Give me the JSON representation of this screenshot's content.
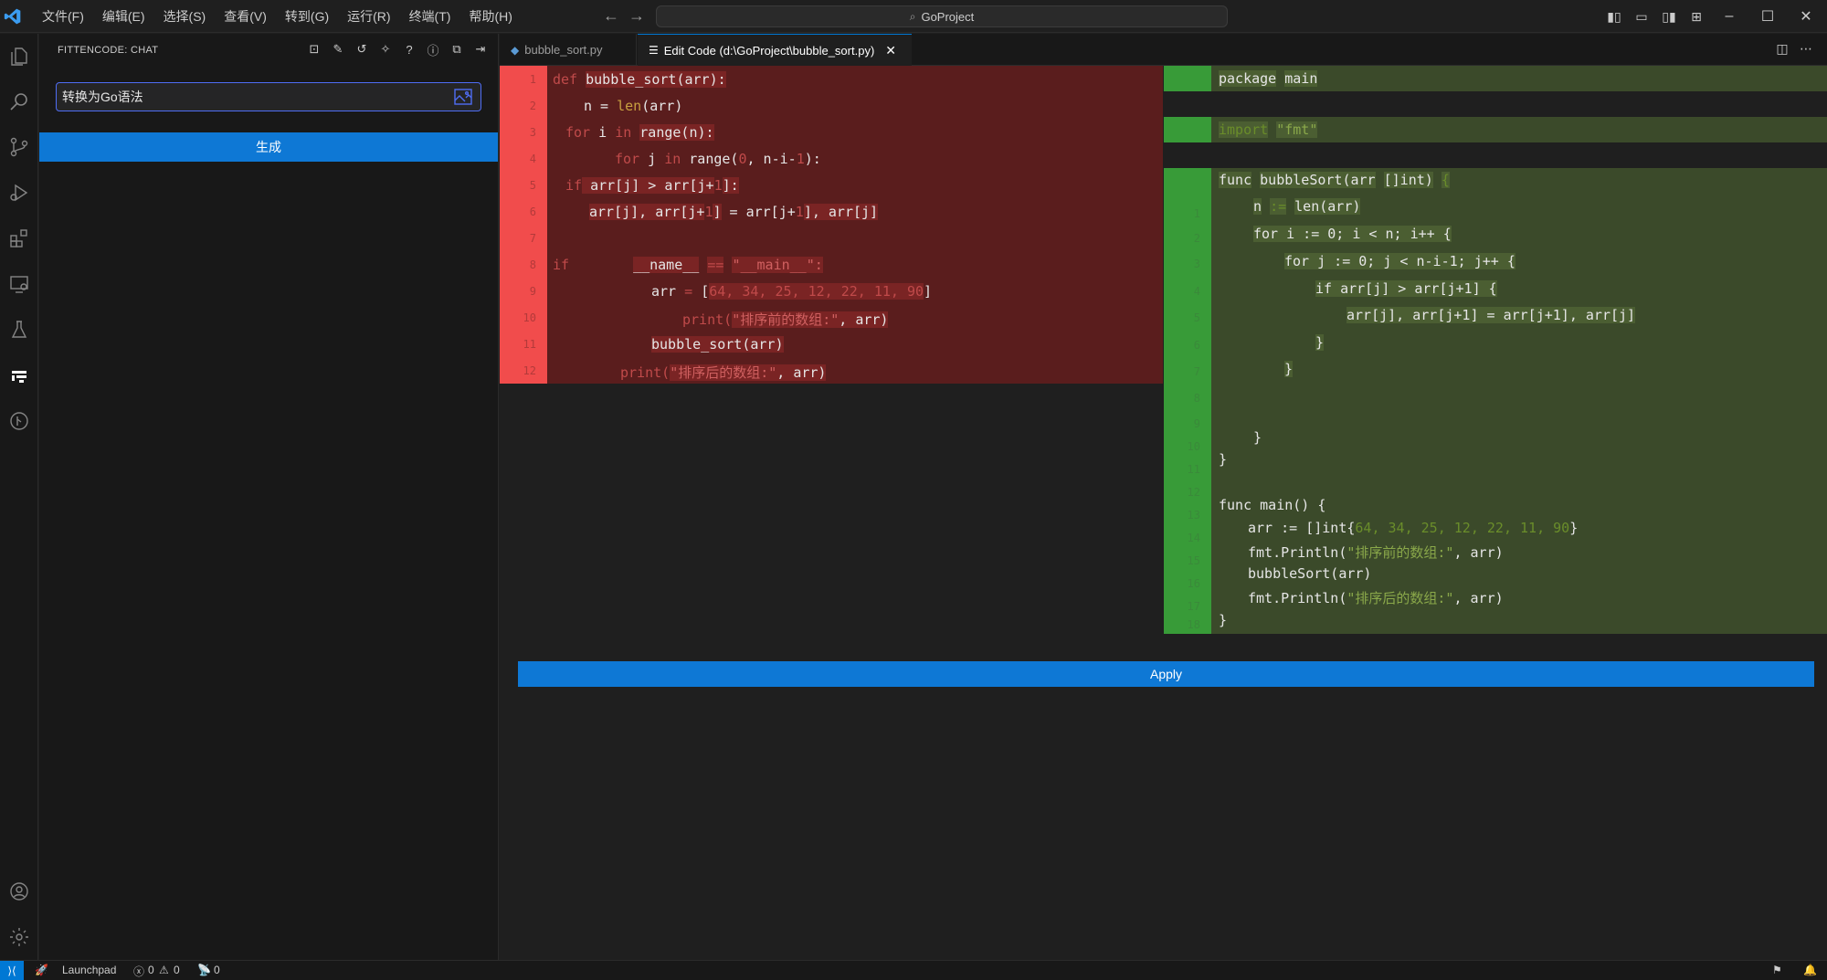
{
  "menu": [
    "文件(F)",
    "编辑(E)",
    "选择(S)",
    "查看(V)",
    "转到(G)",
    "运行(R)",
    "终端(T)",
    "帮助(H)"
  ],
  "search": {
    "label": "GoProject"
  },
  "sidebar": {
    "title": "FITTENCODE: CHAT",
    "input_value": "转换为Go语法",
    "generate_label": "生成"
  },
  "tabs": [
    {
      "label": "bubble_sort.py",
      "icon": "python-file-icon"
    },
    {
      "label": "Edit Code (d:\\GoProject\\bubble_sort.py)",
      "icon": "edit-icon"
    }
  ],
  "left_code": {
    "line_numbers": [
      "1",
      "2",
      "3",
      "4",
      "5",
      "6",
      "7",
      "8",
      "9",
      "10",
      "11",
      "12"
    ],
    "l1a": "def",
    "l1b": "bubble_sort(arr):",
    "l2a": "n = ",
    "l2b": "len",
    "l2c": "(arr)",
    "l3a": "for",
    "l3b": " i ",
    "l3c": "in",
    "l3d": "range(n):",
    "l4a": "for",
    "l4b": " j ",
    "l4c": "in",
    "l4d": "range(",
    "l4e": "0",
    "l4f": ", n-i-",
    "l4g": "1",
    "l4h": "):",
    "l5a": "if",
    "l5b": " arr[j]",
    "l5c": " > arr[j+",
    "l5d": "1",
    "l5e": "]:",
    "l6a": "arr[j],",
    "l6b": " arr[j+",
    "l6c": "1",
    "l6d": "]",
    "l6e": " = arr[j+",
    "l6f": "1",
    "l6g": "], arr[j]",
    "l8a": "if",
    "l8b": "__name__",
    "l8c": "==",
    "l8d": "\"__main__\":",
    "l9a": "arr",
    "l9b": "=",
    "l9c": "[",
    "l9d": "64, 34, 25, 12, 22, 11, 90",
    "l9e": "]",
    "l10a": "print(",
    "l10b": "\"排序前的数组:\"",
    "l10c": ", arr)",
    "l11": "bubble_sort(arr)",
    "l12a": "print(",
    "l12b": "\"排序后的数组:\"",
    "l12c": ", arr)"
  },
  "right_code": {
    "line_numbers": [
      "1",
      "2",
      "3",
      "4",
      "5",
      "6",
      "7",
      "8",
      "9",
      "10",
      "11",
      "12",
      "13",
      "14",
      "15",
      "16",
      "17",
      "18",
      "19",
      "20",
      "21",
      "22"
    ],
    "r1a": "package",
    "r1b": "main",
    "r3a": "import",
    "r3b": "\"fmt\"",
    "r5a": "func",
    "r5b": "bubbleSort(arr",
    "r5c": "[]int)",
    "r5d": "{",
    "r6a": "n",
    "r6b": ":=",
    "r6c": "len(arr)",
    "r7": "for i := 0; i < n; i++ {",
    "r8": "for j := 0; j < n-i-1; j++ {",
    "r9": "if arr[j] > arr[j+1] {",
    "r10": "arr[j], arr[j+1] = arr[j+1], arr[j]",
    "r11": "}",
    "r12": "}",
    "r15": "}",
    "r16": "}",
    "r18": "func main() {",
    "r19a": "arr := []int{",
    "r19b": "64, 34, 25, 12, 22, 11, 90",
    "r19c": "}",
    "r20a": "fmt.Println(",
    "r20b": "\"排序前的数组:\"",
    "r20c": ", arr)",
    "r21": "bubbleSort(arr)",
    "r22a": "fmt.Println(",
    "r22b": "\"排序后的数组:\"",
    "r22c": ", arr)",
    "r23": "}"
  },
  "apply_label": "Apply",
  "status": {
    "launchpad": "Launchpad",
    "errors": "0",
    "warnings": "0",
    "ports": "0"
  }
}
